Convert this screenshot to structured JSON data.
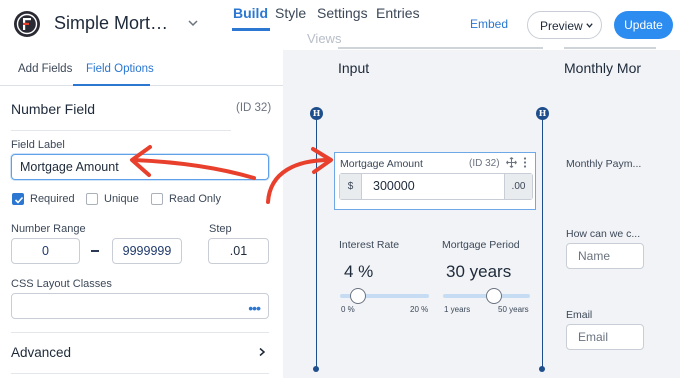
{
  "header": {
    "form_title": "Simple Mortgag...",
    "tabs": [
      {
        "label": "Build",
        "active": true
      },
      {
        "label": "Style",
        "active": false
      },
      {
        "label": "Settings",
        "active": false
      },
      {
        "label": "Entries",
        "active": false
      },
      {
        "label": "Views",
        "active": false
      }
    ],
    "embed_label": "Embed",
    "preview_label": "Preview",
    "update_label": "Update"
  },
  "sidebar": {
    "tabs": [
      {
        "label": "Add Fields",
        "active": false
      },
      {
        "label": "Field Options",
        "active": true
      }
    ],
    "section_title": "Number Field",
    "section_id": "(ID 32)",
    "field_label_caption": "Field Label",
    "field_label_value": "Mortgage Amount",
    "checkboxes": [
      {
        "label": "Required",
        "checked": true
      },
      {
        "label": "Unique",
        "checked": false
      },
      {
        "label": "Read Only",
        "checked": false
      }
    ],
    "number_range_caption": "Number Range",
    "range_min": "0",
    "range_max": "9999999",
    "step_caption": "Step",
    "step_value": ".01",
    "css_caption": "CSS Layout Classes",
    "css_value": "",
    "css_dots": "•••",
    "advanced_label": "Advanced"
  },
  "canvas": {
    "columns": [
      {
        "title": "Input",
        "marker": "H"
      },
      {
        "title": "Monthly Mor",
        "marker": "H"
      }
    ],
    "selected_field": {
      "label": "Mortgage Amount",
      "id": "(ID 32)",
      "prefix": "$",
      "value": "300000",
      "suffix": ".00"
    },
    "sliders": [
      {
        "label": "Interest Rate",
        "value_text": "4 %",
        "min_label": "0 %",
        "max_label": "20 %",
        "fraction": 0.2
      },
      {
        "label": "Mortgage Period",
        "value_text": "30 years",
        "min_label": "1 years",
        "max_label": "50 years",
        "fraction": 0.59
      }
    ],
    "right_fields": [
      {
        "label": "Monthly Paym...",
        "placeholder": ""
      },
      {
        "label": "How can we c...",
        "placeholder": "Name"
      },
      {
        "label": "Email",
        "placeholder": "Email"
      }
    ]
  },
  "colors": {
    "accent": "#2b77d1",
    "update_button": "#2d8cf0",
    "annotation_arrow": "#e8402c",
    "column_marker": "#1f4e8c"
  }
}
